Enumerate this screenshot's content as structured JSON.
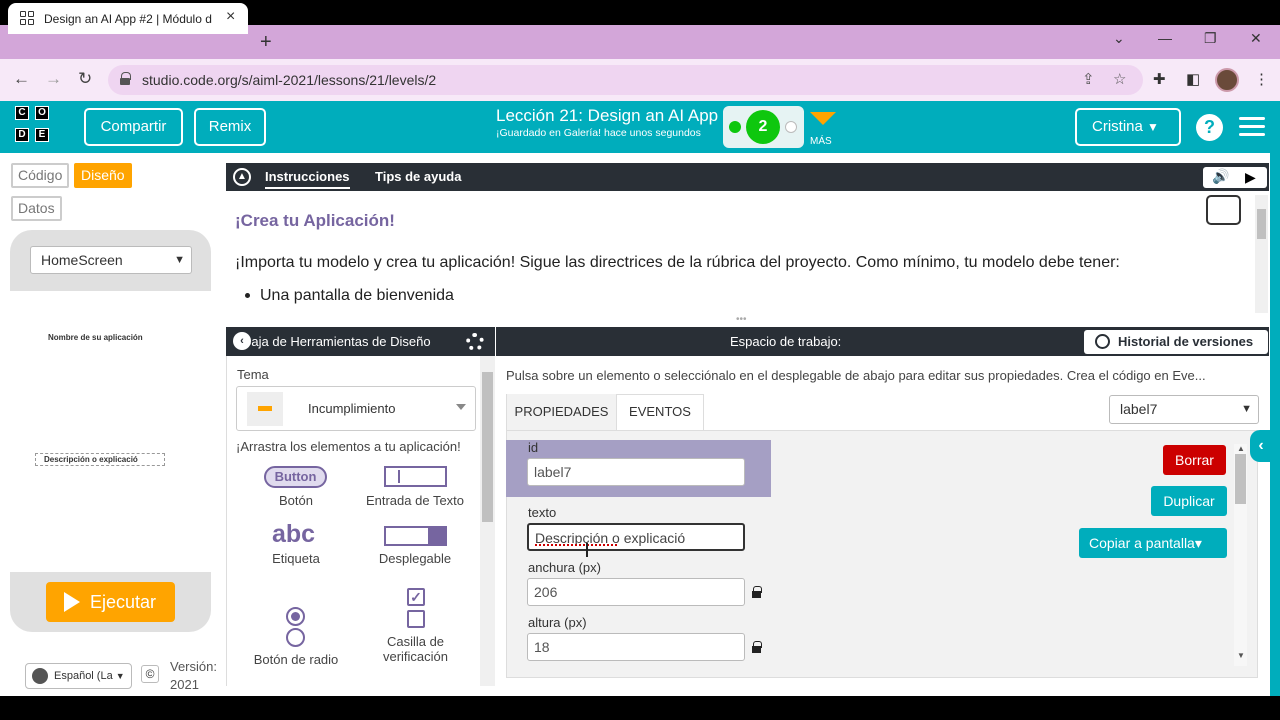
{
  "browser": {
    "tab_title": "Design an AI App #2 | Módulo d",
    "url": "studio.code.org/s/aiml-2021/lessons/21/levels/2"
  },
  "header": {
    "logo_letters": [
      "C",
      "O",
      "D",
      "E"
    ],
    "share_label": "Compartir",
    "remix_label": "Remix",
    "lesson_title": "Lección 21: Design an AI App",
    "saved_status": "¡Guardado en Galería! hace unos segundos",
    "progress_level": "2",
    "more_label": "MÁS",
    "user_name": "Cristina",
    "help_label": "?"
  },
  "left": {
    "mode_code": "Código",
    "mode_design": "Diseño",
    "mode_data": "Datos",
    "screen_selected": "HomeScreen",
    "app_label_1": "Nombre de su aplicación",
    "app_label_2": "Descripción o explicació",
    "run_label": "Ejecutar",
    "language": "Español (La",
    "copyright": "©",
    "version": "Versión: 2021"
  },
  "instructions": {
    "tab_instructions": "Instrucciones",
    "tab_tips": "Tips de ayuda",
    "title": "¡Crea tu Aplicación!",
    "text": "¡Importa tu modelo y crea tu aplicación! Sigue las directrices de la rúbrica del proyecto. Como mínimo, tu modelo debe tener:",
    "bullet_1": "Una pantalla de bienvenida"
  },
  "toolbox": {
    "title": "Caja de Herramientas de Diseño",
    "theme_label": "Tema",
    "theme_value": "Incumplimiento",
    "drag_hint": "¡Arrastra los elementos a tu aplicación!",
    "button_preview": "Button",
    "button_label": "Botón",
    "textinput_label": "Entrada de Texto",
    "abc_preview": "abc",
    "label_label": "Etiqueta",
    "dropdown_label": "Desplegable",
    "radio_label": "Botón de radio",
    "checkbox_label": "Casilla de verificación"
  },
  "workspace": {
    "title": "Espacio de trabajo:",
    "history_label": "Historial de versiones",
    "hint": "Pulsa sobre un elemento o selecciónalo en el desplegable de abajo para editar sus propiedades. Crea el código en Eve...",
    "tab_properties": "PROPIEDADES",
    "tab_events": "EVENTOS",
    "element_selected": "label7",
    "id_label": "id",
    "id_value": "label7",
    "text_label": "texto",
    "text_value": "Descripción o explicació",
    "width_label": "anchura (px)",
    "width_value": "206",
    "height_label": "altura (px)",
    "height_value": "18",
    "delete_label": "Borrar",
    "duplicate_label": "Duplicar",
    "copy_label": "Copiar a pantalla▾"
  }
}
